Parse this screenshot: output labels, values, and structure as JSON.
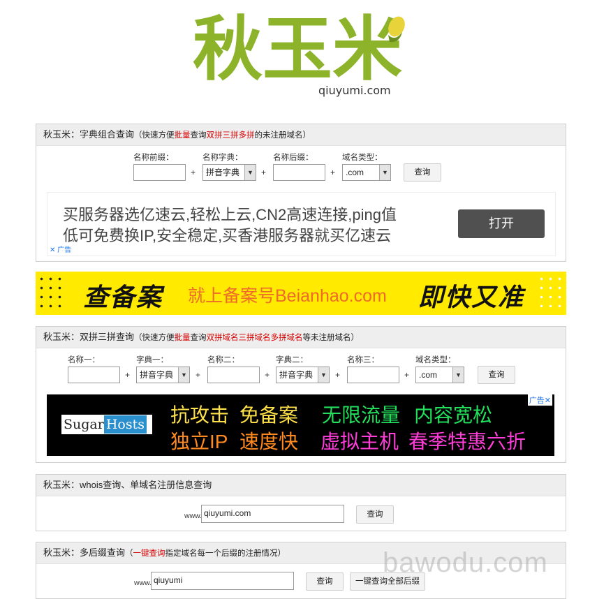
{
  "logo": {
    "chars": "秋玉米",
    "domain": "qiuyumi.com"
  },
  "panel1": {
    "title_prefix": "秋玉米：字典组合查询",
    "desc": [
      "（快速方便",
      "批量",
      "查询",
      "双拼三拼多拼",
      "的未注册域名）"
    ],
    "labels": {
      "prefix": "名称前缀：",
      "dict": "名称字典：",
      "suffix": "名称后缀：",
      "type": "域名类型："
    },
    "dict_value": "拼音字典",
    "type_value": ".com",
    "plus": "+",
    "query": "查询",
    "ad": {
      "line1": "买服务器选亿速云,轻松上云,CN2高速连接,ping值",
      "line2": "低可免费换IP,安全稳定,买香港服务器就买亿速云",
      "button": "打开",
      "mark": "广告"
    }
  },
  "banner": {
    "left": "查备案",
    "middle": "就上备案号Beianhao.com",
    "right": "即快又准"
  },
  "panel2": {
    "title_prefix": "秋玉米：双拼三拼查询",
    "desc": [
      "（快速方便",
      "批量",
      "查询",
      "双拼域名三拼域名多拼域名",
      "等未注册域名）"
    ],
    "labels": {
      "name1": "名称一：",
      "dict1": "字典一：",
      "name2": "名称二：",
      "dict2": "字典二：",
      "name3": "名称三：",
      "type": "域名类型："
    },
    "dict_value": "拼音字典",
    "type_value": ".com",
    "plus": "+",
    "query": "查询",
    "ad": {
      "brand_a": "Sugar",
      "brand_b": "Hosts",
      "adlabel": "广告",
      "t1": "抗攻击",
      "t2": "免备案",
      "t3": "无限流量",
      "t4": "内容宽松",
      "t5": "独立IP",
      "t6": "速度快",
      "t7": "虚拟主机",
      "t8": "春季特惠六折"
    }
  },
  "panel3": {
    "title": "秋玉米：whois查询、单域名注册信息查询",
    "www": "www.",
    "value": "qiuyumi.com",
    "query": "查询"
  },
  "panel4": {
    "title_prefix": "秋玉米：多后缀查询",
    "desc": [
      "（",
      "一键查询",
      "指定域名每一个后缀的注册情况）"
    ],
    "www": "www.",
    "value": "qiuyumi",
    "query": "查询",
    "query_all": "一键查询全部后缀"
  },
  "watermark": "bawodu.com",
  "colors": {
    "logo_green": "#8cb32a",
    "logo_dark": "#5b6e1a",
    "banner_yellow": "#ffea00",
    "accent_red": "#d40000"
  }
}
